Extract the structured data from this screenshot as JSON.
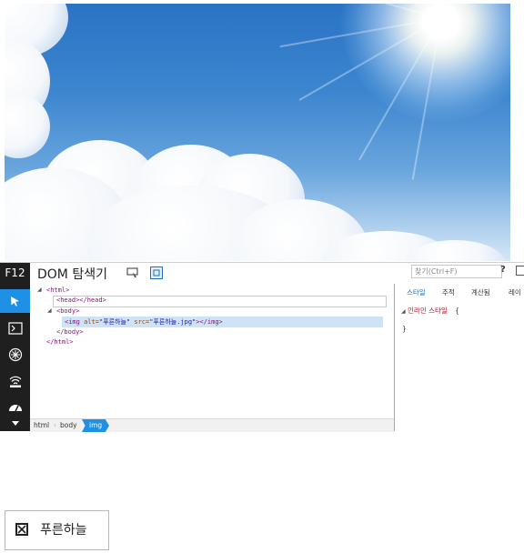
{
  "devtools": {
    "f12_label": "F12",
    "panel_title": "DOM 탐색기",
    "search_placeholder": "찾기(Ctrl+F)",
    "help_label": "?",
    "dom_lines": {
      "html_open": "<html>",
      "head": "<head></head>",
      "body_open": "<body>",
      "img_tag_open": "<img",
      "img_alt_attr": "alt=",
      "img_alt_val": "\"푸른하늘\"",
      "img_src_attr": "src=",
      "img_src_val": "\"푸른하늘.jpg\"",
      "img_close": "></img>",
      "body_close": "</body>",
      "html_close": "</html>"
    },
    "right_tabs": [
      "스타일",
      "추적",
      "계산됨",
      "레이"
    ],
    "inline_style_label": "인라인 스타일",
    "brace_open": "{",
    "brace_close": "}",
    "breadcrumbs": [
      "html",
      "body",
      "img"
    ],
    "accent_color": "#1e90e6"
  },
  "image_alt": {
    "text": "푸른하늘"
  }
}
